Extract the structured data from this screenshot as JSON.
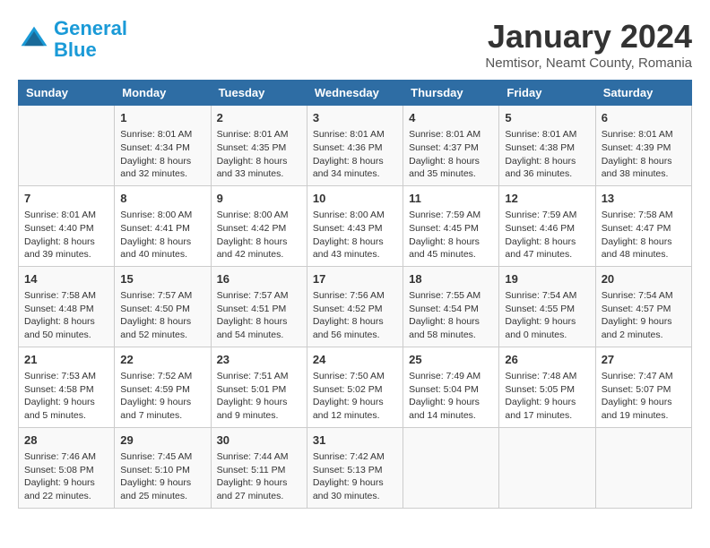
{
  "header": {
    "logo_line1": "General",
    "logo_line2": "Blue",
    "title": "January 2024",
    "subtitle": "Nemtisor, Neamt County, Romania"
  },
  "weekdays": [
    "Sunday",
    "Monday",
    "Tuesday",
    "Wednesday",
    "Thursday",
    "Friday",
    "Saturday"
  ],
  "weeks": [
    [
      {
        "day": "",
        "info": ""
      },
      {
        "day": "1",
        "info": "Sunrise: 8:01 AM\nSunset: 4:34 PM\nDaylight: 8 hours\nand 32 minutes."
      },
      {
        "day": "2",
        "info": "Sunrise: 8:01 AM\nSunset: 4:35 PM\nDaylight: 8 hours\nand 33 minutes."
      },
      {
        "day": "3",
        "info": "Sunrise: 8:01 AM\nSunset: 4:36 PM\nDaylight: 8 hours\nand 34 minutes."
      },
      {
        "day": "4",
        "info": "Sunrise: 8:01 AM\nSunset: 4:37 PM\nDaylight: 8 hours\nand 35 minutes."
      },
      {
        "day": "5",
        "info": "Sunrise: 8:01 AM\nSunset: 4:38 PM\nDaylight: 8 hours\nand 36 minutes."
      },
      {
        "day": "6",
        "info": "Sunrise: 8:01 AM\nSunset: 4:39 PM\nDaylight: 8 hours\nand 38 minutes."
      }
    ],
    [
      {
        "day": "7",
        "info": "Sunrise: 8:01 AM\nSunset: 4:40 PM\nDaylight: 8 hours\nand 39 minutes."
      },
      {
        "day": "8",
        "info": "Sunrise: 8:00 AM\nSunset: 4:41 PM\nDaylight: 8 hours\nand 40 minutes."
      },
      {
        "day": "9",
        "info": "Sunrise: 8:00 AM\nSunset: 4:42 PM\nDaylight: 8 hours\nand 42 minutes."
      },
      {
        "day": "10",
        "info": "Sunrise: 8:00 AM\nSunset: 4:43 PM\nDaylight: 8 hours\nand 43 minutes."
      },
      {
        "day": "11",
        "info": "Sunrise: 7:59 AM\nSunset: 4:45 PM\nDaylight: 8 hours\nand 45 minutes."
      },
      {
        "day": "12",
        "info": "Sunrise: 7:59 AM\nSunset: 4:46 PM\nDaylight: 8 hours\nand 47 minutes."
      },
      {
        "day": "13",
        "info": "Sunrise: 7:58 AM\nSunset: 4:47 PM\nDaylight: 8 hours\nand 48 minutes."
      }
    ],
    [
      {
        "day": "14",
        "info": "Sunrise: 7:58 AM\nSunset: 4:48 PM\nDaylight: 8 hours\nand 50 minutes."
      },
      {
        "day": "15",
        "info": "Sunrise: 7:57 AM\nSunset: 4:50 PM\nDaylight: 8 hours\nand 52 minutes."
      },
      {
        "day": "16",
        "info": "Sunrise: 7:57 AM\nSunset: 4:51 PM\nDaylight: 8 hours\nand 54 minutes."
      },
      {
        "day": "17",
        "info": "Sunrise: 7:56 AM\nSunset: 4:52 PM\nDaylight: 8 hours\nand 56 minutes."
      },
      {
        "day": "18",
        "info": "Sunrise: 7:55 AM\nSunset: 4:54 PM\nDaylight: 8 hours\nand 58 minutes."
      },
      {
        "day": "19",
        "info": "Sunrise: 7:54 AM\nSunset: 4:55 PM\nDaylight: 9 hours\nand 0 minutes."
      },
      {
        "day": "20",
        "info": "Sunrise: 7:54 AM\nSunset: 4:57 PM\nDaylight: 9 hours\nand 2 minutes."
      }
    ],
    [
      {
        "day": "21",
        "info": "Sunrise: 7:53 AM\nSunset: 4:58 PM\nDaylight: 9 hours\nand 5 minutes."
      },
      {
        "day": "22",
        "info": "Sunrise: 7:52 AM\nSunset: 4:59 PM\nDaylight: 9 hours\nand 7 minutes."
      },
      {
        "day": "23",
        "info": "Sunrise: 7:51 AM\nSunset: 5:01 PM\nDaylight: 9 hours\nand 9 minutes."
      },
      {
        "day": "24",
        "info": "Sunrise: 7:50 AM\nSunset: 5:02 PM\nDaylight: 9 hours\nand 12 minutes."
      },
      {
        "day": "25",
        "info": "Sunrise: 7:49 AM\nSunset: 5:04 PM\nDaylight: 9 hours\nand 14 minutes."
      },
      {
        "day": "26",
        "info": "Sunrise: 7:48 AM\nSunset: 5:05 PM\nDaylight: 9 hours\nand 17 minutes."
      },
      {
        "day": "27",
        "info": "Sunrise: 7:47 AM\nSunset: 5:07 PM\nDaylight: 9 hours\nand 19 minutes."
      }
    ],
    [
      {
        "day": "28",
        "info": "Sunrise: 7:46 AM\nSunset: 5:08 PM\nDaylight: 9 hours\nand 22 minutes."
      },
      {
        "day": "29",
        "info": "Sunrise: 7:45 AM\nSunset: 5:10 PM\nDaylight: 9 hours\nand 25 minutes."
      },
      {
        "day": "30",
        "info": "Sunrise: 7:44 AM\nSunset: 5:11 PM\nDaylight: 9 hours\nand 27 minutes."
      },
      {
        "day": "31",
        "info": "Sunrise: 7:42 AM\nSunset: 5:13 PM\nDaylight: 9 hours\nand 30 minutes."
      },
      {
        "day": "",
        "info": ""
      },
      {
        "day": "",
        "info": ""
      },
      {
        "day": "",
        "info": ""
      }
    ]
  ]
}
